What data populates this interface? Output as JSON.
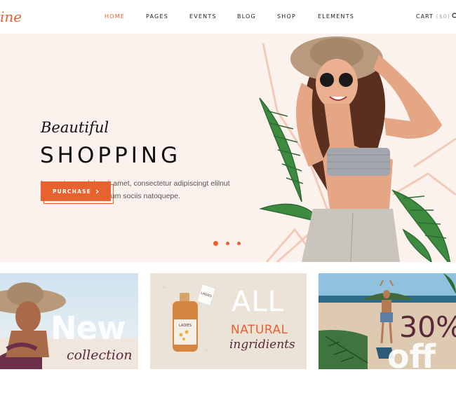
{
  "brand": {
    "logo_text": "ine"
  },
  "nav": {
    "items": [
      {
        "label": "HOME",
        "active": true
      },
      {
        "label": "PAGES",
        "active": false
      },
      {
        "label": "EVENTS",
        "active": false
      },
      {
        "label": "BLOG",
        "active": false
      },
      {
        "label": "SHOP",
        "active": false
      },
      {
        "label": "ELEMENTS",
        "active": false
      }
    ],
    "cart_label": "CART",
    "cart_amount": "($0)"
  },
  "hero": {
    "script_title": "Beautiful",
    "title": "SHOPPING",
    "text_line1": "Lorem ipsum dolor sit amet, consectetur adipiscingt elilnut",
    "text_line2": "leo eget euismod orcium sociis natoquepe.",
    "button_label": "PURCHASE",
    "slides": 3,
    "active_slide": 1
  },
  "promos": [
    {
      "big": "New",
      "script": "collection"
    },
    {
      "big": "ALL",
      "line2": "NATURAL",
      "script": "ingridients",
      "bottle_label": "LADIES",
      "tag_label": "LADIES"
    },
    {
      "big": "30%",
      "line2": "off"
    }
  ],
  "colors": {
    "accent": "#e8612f",
    "hero_bg": "#fbf2ee",
    "plum": "#5a2a3c"
  },
  "icons": [
    "search-icon",
    "chevron-right-icon"
  ]
}
